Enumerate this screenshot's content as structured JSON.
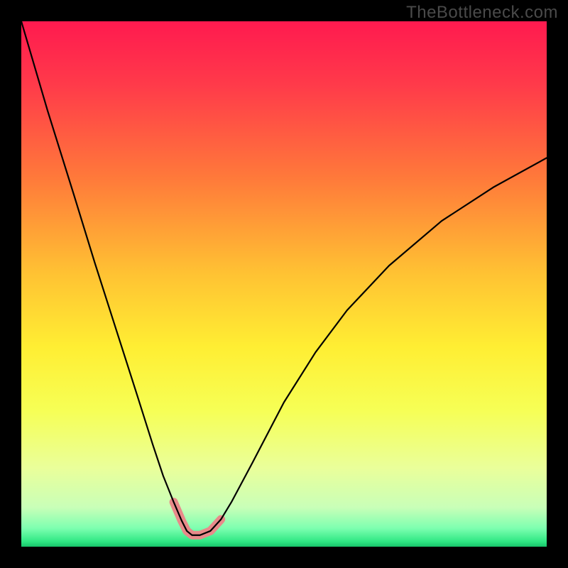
{
  "watermark": "TheBottleneck.com",
  "chart_data": {
    "type": "line",
    "title": "",
    "xlabel": "",
    "ylabel": "",
    "xlim": [
      0,
      100
    ],
    "ylim": [
      0,
      100
    ],
    "grid": false,
    "series": [
      {
        "name": "bottleneck-curve",
        "x": [
          0,
          5,
          10,
          14,
          18,
          22,
          25,
          27,
          29,
          30.5,
          31.5,
          32.5,
          34,
          36,
          38,
          40,
          44,
          50,
          56,
          62,
          70,
          80,
          90,
          100
        ],
        "y": [
          100,
          83,
          67,
          54,
          41.5,
          29,
          19.5,
          13.5,
          8.5,
          5,
          3,
          2.2,
          2.2,
          3,
          5.2,
          8.5,
          16,
          27.5,
          37,
          45,
          53.5,
          62,
          68.5,
          74
        ],
        "color": "#000000",
        "width": 2.2
      }
    ],
    "highlight": {
      "name": "v-well-highlight",
      "x": [
        29,
        30.5,
        31.5,
        32.5,
        34,
        36,
        38
      ],
      "y": [
        8.5,
        5,
        3,
        2.2,
        2.2,
        3,
        5.2
      ],
      "color": "#e88a8a",
      "width": 12
    },
    "background_gradient": {
      "stops": [
        {
          "offset": 0.0,
          "color": "#ff1a4f"
        },
        {
          "offset": 0.12,
          "color": "#ff3a4a"
        },
        {
          "offset": 0.3,
          "color": "#ff7a3a"
        },
        {
          "offset": 0.48,
          "color": "#ffc233"
        },
        {
          "offset": 0.62,
          "color": "#ffee33"
        },
        {
          "offset": 0.74,
          "color": "#f6ff55"
        },
        {
          "offset": 0.85,
          "color": "#eaff9a"
        },
        {
          "offset": 0.925,
          "color": "#c9ffb8"
        },
        {
          "offset": 0.965,
          "color": "#7dffb0"
        },
        {
          "offset": 0.99,
          "color": "#30e884"
        },
        {
          "offset": 1.0,
          "color": "#17c46a"
        }
      ]
    }
  }
}
